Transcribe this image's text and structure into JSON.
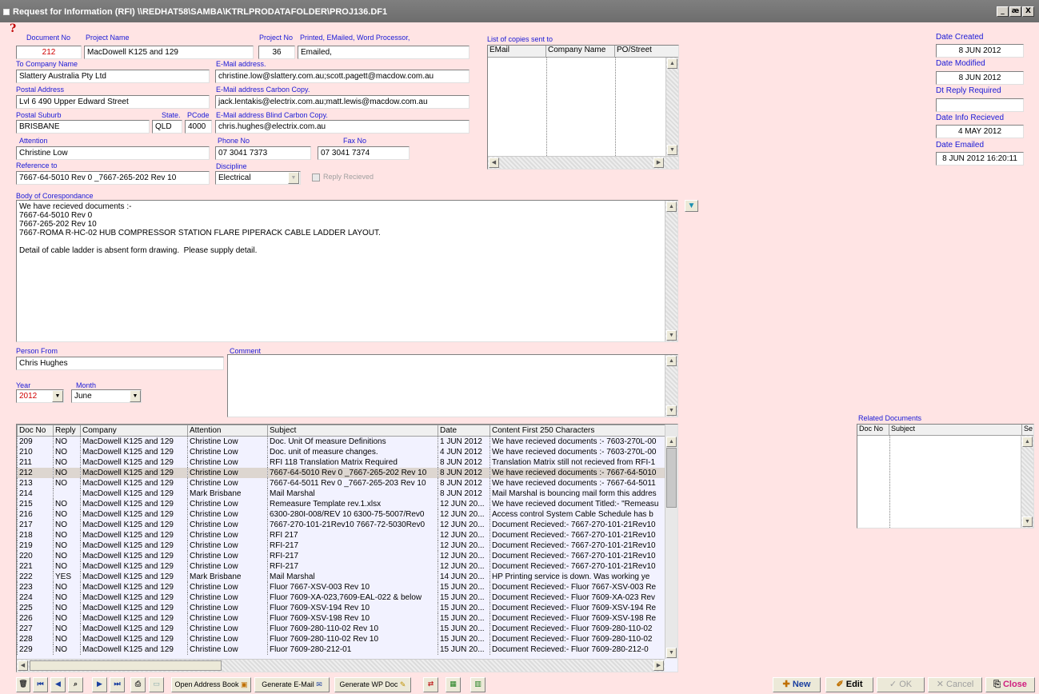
{
  "window": {
    "title": "Request for Information (RFI) \\\\REDHAT58\\SAMBA\\KTRLPRODATAFOLDER\\PROJ136.DF1",
    "btn_minimize": "_",
    "btn_restore": "æ",
    "btn_close": "X"
  },
  "form": {
    "help_icon": "question-mark-icon",
    "document_no_label": "Document No",
    "document_no": "212",
    "project_name_label": "Project Name",
    "project_name": "MacDowell K125 and 129",
    "project_no_label": "Project No",
    "project_no": "36",
    "printed_label": "Printed, EMailed, Word Processor,",
    "printed": "Emailed,",
    "to_company_label": "To Company Name",
    "to_company": "Slattery Australia Pty Ltd",
    "email_label": "E-Mail address.",
    "email": "christine.low@slattery.com.au;scott.pagett@macdow.com.au",
    "postal_address_label": "Postal Address",
    "postal_address": "Lvl 6 490 Upper Edward Street",
    "email_cc_label": "E-Mail address Carbon Copy.",
    "email_cc": "jack.lentakis@electrix.com.au;matt.lewis@macdow.com.au",
    "postal_suburb_label": "Postal Suburb",
    "postal_suburb": "BRISBANE",
    "state_label": "State.",
    "state": "QLD",
    "pcode_label": "PCode",
    "pcode": "4000",
    "email_bcc_label": "E-Mail address Blind Carbon Copy.",
    "email_bcc": "chris.hughes@electrix.com.au",
    "attention_label": "Attention",
    "attention": "Christine Low",
    "phone_label": "Phone No",
    "phone": "07 3041 7373",
    "fax_label": "Fax No",
    "fax": "07 3041 7374",
    "reference_label": "Reference to",
    "reference": "7667-64-5010 Rev 0 _7667-265-202 Rev 10",
    "discipline_label": "Discipline",
    "discipline": "Electrical",
    "reply_received_label": "Reply Recieved",
    "body_label": "Body of Corespondance",
    "body_lines": [
      "We have recieved documents :-",
      "7667-64-5010 Rev 0",
      "7667-265-202 Rev 10",
      "7667-ROMA R-HC-02 HUB COMPRESSOR STATION FLARE PIPERACK CABLE LADDER LAYOUT.",
      "",
      "Detail of cable ladder is absent form drawing.  Please supply detail."
    ],
    "person_from_label": "Person From",
    "person_from": "Chris Hughes",
    "comment_label": "Comment",
    "year_label": "Year",
    "year": "2012",
    "month_label": "Month",
    "month": "June"
  },
  "copies": {
    "label": "List of copies sent to",
    "columns": [
      "EMail",
      "Company Name",
      "PO/Street"
    ]
  },
  "dates": {
    "created_label": "Date Created",
    "created": "8 JUN 2012",
    "modified_label": "Date Modified",
    "modified": "8 JUN 2012",
    "reply_required_label": "Dt Reply Required",
    "reply_required": "",
    "info_received_label": "Date Info Recieved",
    "info_received": "4 MAY 2012",
    "emailed_label": "Date Emailed",
    "emailed": "8 JUN 2012  16:20:11"
  },
  "related": {
    "label": "Related Documents",
    "columns": [
      "Doc No",
      "Subject",
      "Se"
    ]
  },
  "list": {
    "columns": [
      "Doc No",
      "Reply",
      "Company",
      "Attention",
      "Subject",
      "Date",
      "Content First 250 Characters"
    ],
    "selected_index": 3,
    "rows": [
      [
        "209",
        "NO",
        "MacDowell K125 and 129",
        "Christine Low",
        "Doc. Unit Of measure Definitions",
        "1 JUN 2012",
        "We have recieved documents :- 7603-270L-00"
      ],
      [
        "210",
        "NO",
        "MacDowell K125 and 129",
        "Christine Low",
        "Doc. unit of measure changes.",
        "4 JUN 2012",
        "We have recieved documents :- 7603-270L-00"
      ],
      [
        "211",
        "NO",
        "MacDowell K125 and 129",
        "Christine Low",
        "RFI 118 Translation Matrix Required",
        "8 JUN 2012",
        "Translation Matrix still not recieved from RFI-1"
      ],
      [
        "212",
        "NO",
        "MacDowell K125 and 129",
        "Christine Low",
        "7667-64-5010 Rev 0 _7667-265-202 Rev 10",
        "8 JUN 2012",
        "We have recieved documents :- 7667-64-5010"
      ],
      [
        "213",
        "NO",
        "MacDowell K125 and 129",
        "Christine Low",
        "7667-64-5011 Rev 0 _7667-265-203 Rev 10",
        "8 JUN 2012",
        "We have recieved documents :- 7667-64-5011"
      ],
      [
        "214",
        "",
        "MacDowell K125 and 129",
        "Mark Brisbane",
        "Mail Marshal",
        "8 JUN 2012",
        "Mail Marshal is bouncing mail form this addres"
      ],
      [
        "215",
        "NO",
        "MacDowell K125 and 129",
        "Christine Low",
        "Remeasure Template rev.1.xlsx",
        "12 JUN 20...",
        "We have recieved document Titled:- \"Remeasu"
      ],
      [
        "216",
        "NO",
        "MacDowell K125 and 129",
        "Christine Low",
        "6300-280I-008/REV 10 6300-75-5007/Rev0",
        "12 JUN 20...",
        "Access control System Cable Schedule has b"
      ],
      [
        "217",
        "NO",
        "MacDowell K125 and 129",
        "Christine Low",
        "7667-270-101-21Rev10 7667-72-5030Rev0",
        "12 JUN 20...",
        "Document Recieved:-  7667-270-101-21Rev10"
      ],
      [
        "218",
        "NO",
        "MacDowell K125 and 129",
        "Christine Low",
        "RFI 217",
        "12 JUN 20...",
        "Document Recieved:-  7667-270-101-21Rev10"
      ],
      [
        "219",
        "NO",
        "MacDowell K125 and 129",
        "Christine Low",
        "RFI-217",
        "12 JUN 20...",
        "Document Recieved:-  7667-270-101-21Rev10"
      ],
      [
        "220",
        "NO",
        "MacDowell K125 and 129",
        "Christine Low",
        "RFI-217",
        "12 JUN 20...",
        "Document Recieved:-  7667-270-101-21Rev10"
      ],
      [
        "221",
        "NO",
        "MacDowell K125 and 129",
        "Christine Low",
        "RFI-217",
        "12 JUN 20...",
        "Document Recieved:-  7667-270-101-21Rev10"
      ],
      [
        "222",
        "YES",
        "MacDowell K125 and 129",
        "Mark Brisbane",
        "Mail Marshal",
        "14 JUN 20...",
        "HP Printing service is down.  Was working ye"
      ],
      [
        "223",
        "NO",
        "MacDowell K125 and 129",
        "Christine Low",
        "Fluor  7667-XSV-003 Rev 10",
        "15 JUN 20...",
        "Document Recieved:- Fluor  7667-XSV-003 Re"
      ],
      [
        "224",
        "NO",
        "MacDowell K125 and 129",
        "Christine Low",
        "Fluor  7609-XA-023,7609-EAL-022 & below",
        "15 JUN 20...",
        "Document Recieved:- Fluor  7609-XA-023 Rev"
      ],
      [
        "225",
        "NO",
        "MacDowell K125 and 129",
        "Christine Low",
        "Fluor  7609-XSV-194 Rev 10",
        "15 JUN 20...",
        "Document Recieved:- Fluor  7609-XSV-194 Re"
      ],
      [
        "226",
        "NO",
        "MacDowell K125 and 129",
        "Christine Low",
        "Fluor  7609-XSV-198 Rev 10",
        "15 JUN 20...",
        "Document Recieved:- Fluor  7609-XSV-198 Re"
      ],
      [
        "227",
        "NO",
        "MacDowell K125 and 129",
        "Christine Low",
        "Fluor  7609-280-110-02  Rev 10",
        "15 JUN 20...",
        "Document Recieved:-   Fluor  7609-280-110-02"
      ],
      [
        "228",
        "NO",
        "MacDowell K125 and 129",
        "Christine Low",
        "Fluor  7609-280-110-02  Rev 10",
        "15 JUN 20...",
        "Document Recieved:-   Fluor  7609-280-110-02"
      ],
      [
        "229",
        "NO",
        "MacDowell K125 and 129",
        "Christine Low",
        "Fluor  7609-280-212-01",
        "15 JUN 20...",
        "Document Recieved:-   Fluor  7609-280-212-0"
      ]
    ]
  },
  "toolbar": {
    "open_address_book": "Open Address Book",
    "generate_email": "Generate E-Mail",
    "generate_wp": "Generate WP Doc",
    "new": "New",
    "edit": "Edit",
    "ok": "OK",
    "cancel": "Cancel",
    "close": "Close"
  }
}
